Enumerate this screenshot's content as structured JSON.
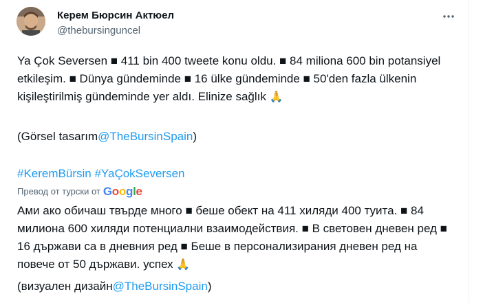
{
  "author": {
    "display_name": "Керем Бюрсин Актюел",
    "handle": "@thebursinguncel",
    "avatar_icon": "profile-photo"
  },
  "tweet": {
    "text_original": "Ya Çok Seversen ■ 411 bin 400 tweete konu oldu. ■ 84 miliona 600 bin potansiyel etkileşim. ■ Dünya gündeminde ■ 16 ülke gündeminde ■ 50'den fazla ülkenin kişileştirilmiş gündeminde yer aldı. Elinize sağlık",
    "emoji": "🙏",
    "credit_prefix_original": "(Görsel tasarım",
    "mention": "@TheBursinSpain",
    "credit_suffix": ")",
    "hashtags": [
      "#KeremBürsin",
      "#YaÇokSeversen"
    ]
  },
  "translation": {
    "label": "Превод от турски от",
    "provider": "Google",
    "text": "Ами ако обичаш твърде много ■ беше обект на 411 хиляди 400 туита. ■ 84 милиона 600 хиляди потенциални взаимодействия. ■ В световен дневен ред ■ 16 държави са в дневния ред ■ Беше в персонализирания дневен ред на повече от 50 държави. успех",
    "credit_prefix": "(визуален дизайн"
  },
  "colors": {
    "link": "#1d9bf0",
    "text": "#0f1419",
    "secondary": "#536471"
  }
}
